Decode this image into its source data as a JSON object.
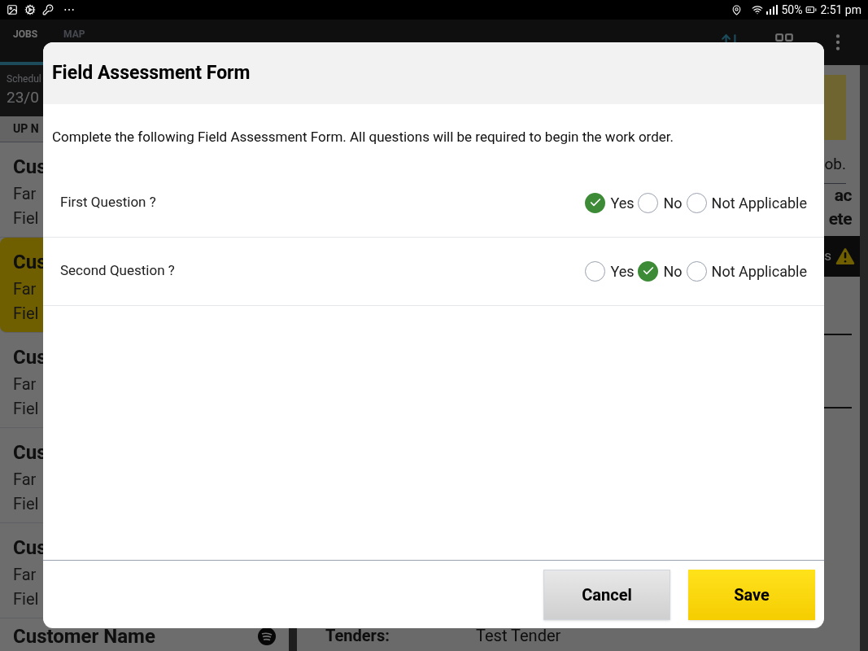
{
  "status_bar": {
    "more": "⋯",
    "battery": "50%",
    "time": "2:51 pm"
  },
  "toolbar": {
    "tabs": [
      {
        "label": "JOBS",
        "selected": true
      },
      {
        "label": "MAP",
        "selected": false
      }
    ]
  },
  "job_list": {
    "header_label": "Schedul",
    "header_date": "23/0",
    "section": "UP N",
    "items": [
      {
        "title": "Cus",
        "line_1": "Far",
        "line_2": "Fiel",
        "selected": false
      },
      {
        "title": "Cus",
        "line_1": "Far",
        "line_2": "Fiel",
        "selected": true
      },
      {
        "title": "Cus",
        "line_1": "Far",
        "line_2": "Fiel",
        "selected": false
      },
      {
        "title": "Cus",
        "line_1": "Far",
        "line_2": "Fiel",
        "selected": false
      },
      {
        "title": "Cus",
        "line_1": "Far",
        "line_2": "Fiel",
        "selected": false
      }
    ],
    "last_item": "Customer Name"
  },
  "details": {
    "note": "ob.",
    "heading_lines": [
      "ac",
      "ete"
    ],
    "alert": "s",
    "tenders_label": "Tenders:",
    "tenders_value": "Test Tender"
  },
  "dialog": {
    "title": "Field Assessment Form",
    "instructions": "Complete the following Field Assessment Form. All questions will be required to begin the work order.",
    "questions": [
      {
        "label": "First Question ?",
        "options": [
          {
            "label": "Yes",
            "selected": true
          },
          {
            "label": "No",
            "selected": false
          },
          {
            "label": "Not Applicable",
            "selected": false
          }
        ]
      },
      {
        "label": "Second Question ?",
        "options": [
          {
            "label": "Yes",
            "selected": false
          },
          {
            "label": "No",
            "selected": true
          },
          {
            "label": "Not Applicable",
            "selected": false
          }
        ]
      }
    ],
    "buttons": [
      {
        "label": "Cancel",
        "kind": "secondary"
      },
      {
        "label": "Save",
        "kind": "primary"
      }
    ]
  }
}
